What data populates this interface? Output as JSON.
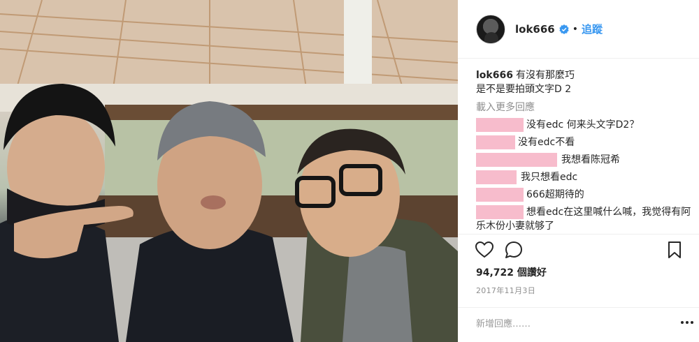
{
  "post": {
    "username": "lok666",
    "follow_label": "追蹤",
    "dot": "•",
    "caption_line1": "有沒有那麼巧",
    "caption_line2": "是不是要拍頭文字D 2",
    "load_more_label": "載入更多回應",
    "comments": [
      {
        "text": "没有edc 何来头文字D2？"
      },
      {
        "text": "没有edc不看"
      },
      {
        "text": "我想看陈冠希"
      },
      {
        "text": "我只想看edc"
      },
      {
        "text": "666超期待的"
      },
      {
        "text": "想看edc在这里喊什么喊，我觉得有阿乐木份小妻就够了"
      }
    ],
    "likes": "94,722 個讚好",
    "date": "2017年11月3日",
    "add_comment_placeholder": "新增回應……"
  },
  "icons": {
    "verified": "verified-badge-icon",
    "like": "heart-icon",
    "comment": "speech-bubble-icon",
    "save": "bookmark-icon",
    "more": "more-options-icon"
  },
  "colors": {
    "accent": "#3897f0",
    "text": "#262626",
    "muted": "#8e8e8e",
    "redaction": "#f7bccc"
  }
}
